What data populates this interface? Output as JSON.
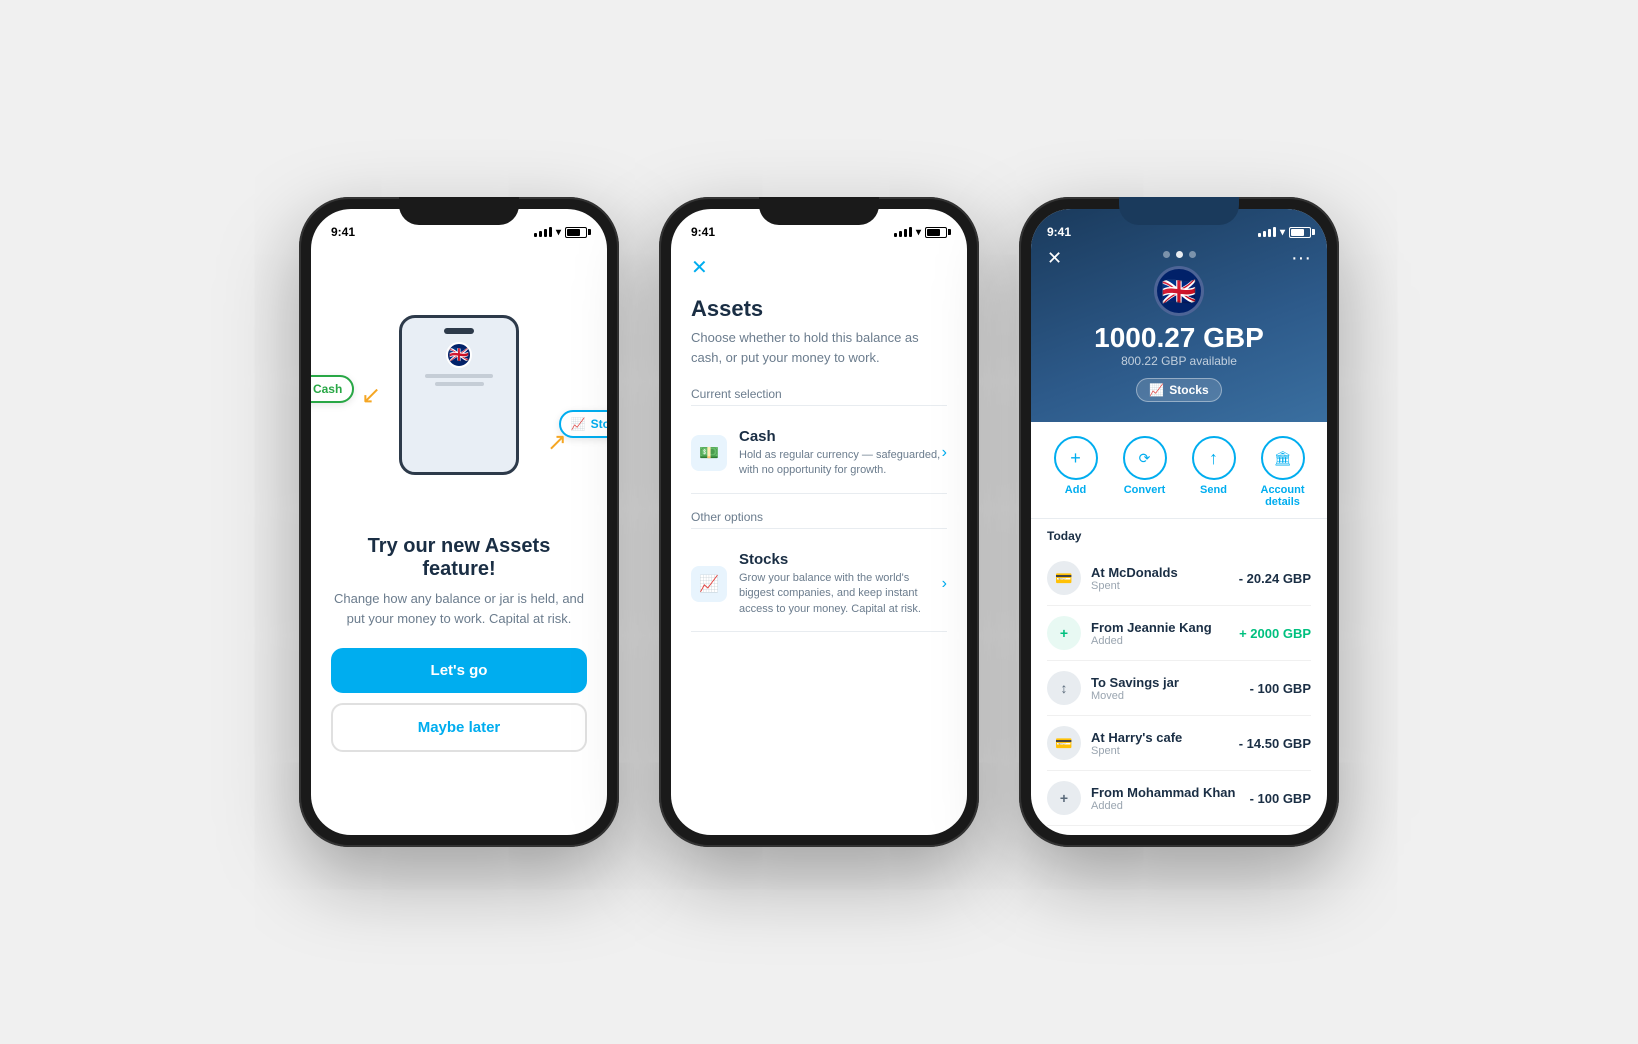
{
  "phone1": {
    "status": {
      "time": "9:41",
      "battery": "70"
    },
    "illustration": {
      "cash_label": "Cash",
      "stocks_label": "Stocks"
    },
    "title": "Try our new Assets feature!",
    "subtitle": "Change how any balance or jar is held, and put your money to work. Capital at risk.",
    "cta_primary": "Let's go",
    "cta_secondary": "Maybe later"
  },
  "phone2": {
    "status": {
      "time": "9:41"
    },
    "close_label": "✕",
    "title": "Assets",
    "subtitle": "Choose whether to hold this balance as cash, or put your money to work.",
    "current_section": "Current selection",
    "current_option": {
      "title": "Cash",
      "description": "Hold as regular currency — safeguarded, with no opportunity for growth."
    },
    "other_section": "Other options",
    "other_option": {
      "title": "Stocks",
      "description": "Grow your balance with the world's biggest companies, and keep instant access to your money. Capital at risk."
    }
  },
  "phone3": {
    "status": {
      "time": "9:41"
    },
    "amount": "1000.27 GBP",
    "available": "800.22 GBP available",
    "asset_type": "Stocks",
    "actions": [
      {
        "label": "Add",
        "icon": "+"
      },
      {
        "label": "Convert",
        "icon": "⟳"
      },
      {
        "label": "Send",
        "icon": "↑"
      },
      {
        "label": "Account\ndetails",
        "icon": "🏛"
      }
    ],
    "section_date": "Today",
    "transactions": [
      {
        "name": "At McDonalds",
        "sub": "Spent",
        "amount": "- 20.24 GBP",
        "positive": false,
        "icon": "💳"
      },
      {
        "name": "From Jeannie Kang",
        "sub": "Added",
        "amount": "+ 2000 GBP",
        "positive": true,
        "icon": "+"
      },
      {
        "name": "To Savings jar",
        "sub": "Moved",
        "amount": "- 100 GBP",
        "positive": false,
        "icon": "↕"
      },
      {
        "name": "At Harry's cafe",
        "sub": "Spent",
        "amount": "- 14.50 GBP",
        "positive": false,
        "icon": "💳"
      },
      {
        "name": "From Mohammad Khan",
        "sub": "Added",
        "amount": "- 100 GBP",
        "positive": false,
        "icon": "+"
      }
    ]
  }
}
